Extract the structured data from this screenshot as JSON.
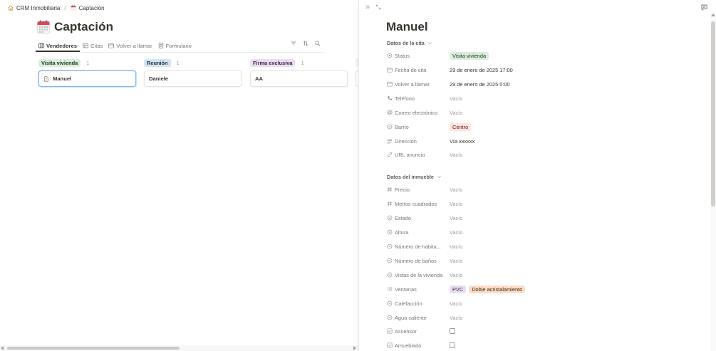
{
  "breadcrumb": {
    "workspace": "CRM Inmobiliaria",
    "separator": "/",
    "page": "Captación"
  },
  "page": {
    "title": "Captación"
  },
  "tabs": [
    {
      "label": "Vendedores",
      "icon": "board-icon",
      "active": true
    },
    {
      "label": "Citas",
      "icon": "table-icon"
    },
    {
      "label": "Volver a llamar",
      "icon": "calendar-icon"
    },
    {
      "label": "Formulario",
      "icon": "form-icon"
    }
  ],
  "toolbar_icons": [
    "filter-icon",
    "sort-icon",
    "search-icon"
  ],
  "board": {
    "columns": [
      {
        "label": "Visita vivienda",
        "count": "1",
        "color": "#dbeddb",
        "text_color": "#1c3829",
        "cards": [
          {
            "title": "Manuel",
            "icon": "page-icon",
            "selected": true
          }
        ]
      },
      {
        "label": "Reunión",
        "count": "1",
        "color": "#d3e5ef",
        "text_color": "#183347",
        "cards": [
          {
            "title": "Daniele"
          }
        ]
      },
      {
        "label": "Firma exclusiva",
        "count": "1",
        "color": "#e8deee",
        "text_color": "#412454",
        "cards": [
          {
            "title": "AA"
          }
        ]
      }
    ]
  },
  "record": {
    "title": "Manuel",
    "sections": [
      {
        "label": "Datos de la cita"
      },
      {
        "label": "Datos del inmueble"
      }
    ],
    "properties": [
      {
        "label": "Status",
        "icon": "status-icon",
        "value": "Visita vivienda",
        "tag_color": "#dbeddb",
        "tag_text": "#1c3829"
      },
      {
        "label": "Fecha de cita",
        "icon": "calendar-icon",
        "value": "29 de enero de 2025 17:00"
      },
      {
        "label": "Volver a llamar",
        "icon": "calendar-icon",
        "value": "29 de enero de 2025 0:00"
      },
      {
        "label": "Teléfono",
        "icon": "phone-icon",
        "value": "Vacío",
        "empty": true
      },
      {
        "label": "Correo electrónico",
        "icon": "at-icon",
        "value": "Vacío",
        "empty": true
      },
      {
        "label": "Barrio",
        "icon": "select-icon",
        "value": "Centro",
        "tag_color": "#ffe2dd",
        "tag_text": "#5d1715"
      },
      {
        "label": "Dirección",
        "icon": "text-icon",
        "value": "Vía xxxxxx"
      },
      {
        "label": "URL anuncio",
        "icon": "link-icon",
        "value": "Vacío",
        "empty": true
      },
      {
        "label": "Precio",
        "icon": "number-icon",
        "value": "Vacío",
        "empty": true
      },
      {
        "label": "Metros cuadrados",
        "icon": "number-icon",
        "value": "Vacío",
        "empty": true
      },
      {
        "label": "Estado",
        "icon": "select-icon",
        "value": "Vacío",
        "empty": true
      },
      {
        "label": "Altura",
        "icon": "select-icon",
        "value": "Vacío",
        "empty": true
      },
      {
        "label": "Número de habita...",
        "icon": "select-icon",
        "value": "Vacío",
        "empty": true
      },
      {
        "label": "Número de baños",
        "icon": "select-icon",
        "value": "Vacío",
        "empty": true
      },
      {
        "label": "Vistas de la vivienda",
        "icon": "select-icon",
        "value": "Vacío",
        "empty": true
      },
      {
        "label": "Ventanas",
        "icon": "multiselect-icon",
        "tags": [
          {
            "value": "PVC",
            "tag_color": "#e8deee",
            "tag_text": "#412454"
          },
          {
            "value": "Doble acristalamiento",
            "tag_color": "#fadec9",
            "tag_text": "#49290e"
          }
        ]
      },
      {
        "label": "Calefacción",
        "icon": "select-icon",
        "value": "Vacío",
        "empty": true
      },
      {
        "label": "Agua caliente",
        "icon": "select-icon",
        "value": "Vacío",
        "empty": true
      },
      {
        "label": "Ascensor",
        "icon": "checkbox-icon",
        "checkbox": false
      },
      {
        "label": "Amueblado",
        "icon": "checkbox-icon",
        "checkbox": false
      }
    ]
  }
}
